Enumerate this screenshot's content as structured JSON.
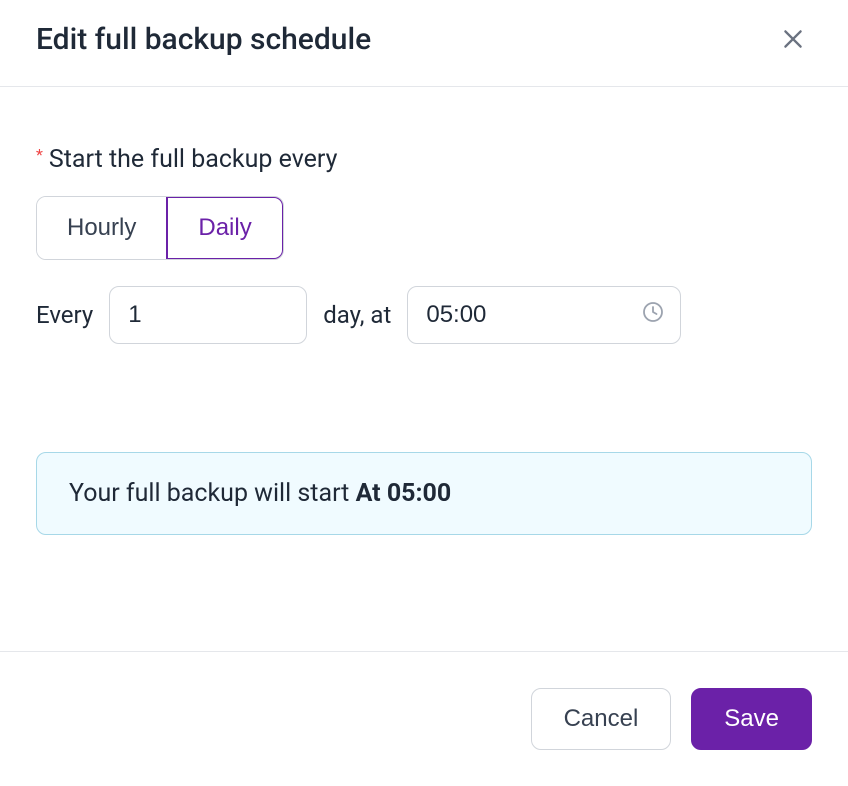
{
  "header": {
    "title": "Edit full backup schedule"
  },
  "form": {
    "frequency_label": "Start the full backup every",
    "options": {
      "hourly": "Hourly",
      "daily": "Daily"
    },
    "selected_option": "daily",
    "every_label": "Every",
    "every_value": "1",
    "unit_label": "day, at",
    "time_value": "05:00"
  },
  "info": {
    "prefix": "Your full backup will start ",
    "bold": "At 05:00"
  },
  "footer": {
    "cancel": "Cancel",
    "save": "Save"
  }
}
